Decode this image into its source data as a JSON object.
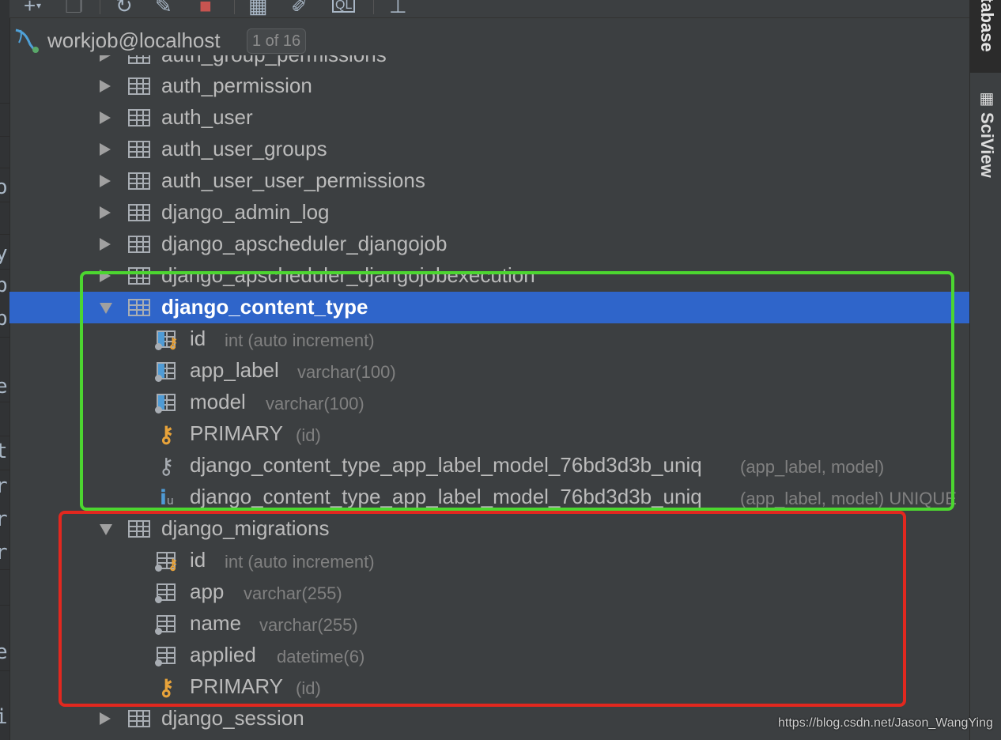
{
  "connection": {
    "name": "workjob@localhost",
    "badge": "1 of 16"
  },
  "side_tabs": {
    "database": "tabase",
    "sciview": "SciView"
  },
  "tables_before": [
    "auth_group_permissions",
    "auth_permission",
    "auth_user",
    "auth_user_groups",
    "auth_user_user_permissions",
    "django_admin_log",
    "django_apscheduler_djangojob",
    "django_apscheduler_djangojobexecution"
  ],
  "content_type_table": {
    "name": "django_content_type",
    "columns": [
      {
        "name": "id",
        "type": "int (auto increment)"
      },
      {
        "name": "app_label",
        "type": "varchar(100)"
      },
      {
        "name": "model",
        "type": "varchar(100)"
      }
    ],
    "primary": {
      "name": "PRIMARY",
      "type": "(id)"
    },
    "index": {
      "name": "django_content_type_app_label_model_76bd3d3b_uniq",
      "type": "(app_label, model)"
    },
    "unique": {
      "name": "django_content_type_app_label_model_76bd3d3b_uniq",
      "type": "(app_label, model) UNIQUE"
    }
  },
  "migrations_table": {
    "name": "django_migrations",
    "columns": [
      {
        "name": "id",
        "type": "int (auto increment)"
      },
      {
        "name": "app",
        "type": "varchar(255)"
      },
      {
        "name": "name",
        "type": "varchar(255)"
      },
      {
        "name": "applied",
        "type": "datetime(6)"
      }
    ],
    "primary": {
      "name": "PRIMARY",
      "type": "(id)"
    }
  },
  "tables_after": [
    "django_session"
  ],
  "gutter_chars": [
    "o",
    "y",
    "b",
    "b",
    "e",
    "t",
    "r",
    "r",
    "r",
    "e",
    "i"
  ],
  "watermark": "https://blog.csdn.net/Jason_WangYing",
  "colors": {
    "background": "#3c3f41",
    "selection": "#2f65ca",
    "green_highlight": "#4cd630",
    "red_highlight": "#e2281f",
    "key": "#e8a33a",
    "column_accent": "#4f9bd5"
  },
  "icons": [
    "add-icon",
    "duplicate-icon",
    "refresh-icon",
    "tool-icon",
    "stop-icon",
    "table-view-icon",
    "edit-icon",
    "sql-console-icon",
    "pin-icon",
    "mysql-icon",
    "table-icon",
    "column-icon",
    "primary-key-icon",
    "key-icon",
    "unique-index-icon"
  ]
}
